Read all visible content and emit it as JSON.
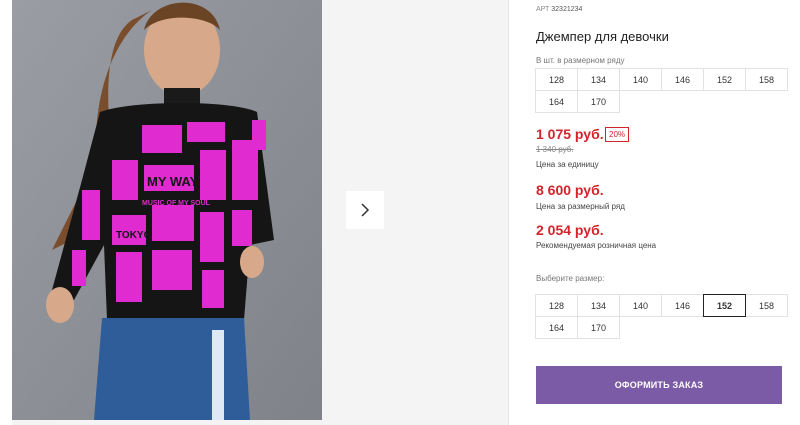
{
  "product": {
    "article_label": "АРТ",
    "article_number": "32321234",
    "title": "Джемпер для девочки"
  },
  "pack_sizes": {
    "label": "В шт. в размерном ряду",
    "sizes": [
      "128",
      "134",
      "140",
      "146",
      "152",
      "158",
      "164",
      "170"
    ]
  },
  "prices": {
    "unit_price": "1 075 руб.",
    "discount": "20%",
    "old_price": "1 340 руб.",
    "unit_caption": "Цена за единицу",
    "row_price": "8 600 руб.",
    "row_caption": "Цена за размерный ряд",
    "retail_price": "2 054 руб.",
    "retail_caption": "Рекомендуемая розничная цена"
  },
  "size_select": {
    "label": "Выберите размер:",
    "sizes": [
      "128",
      "134",
      "140",
      "146",
      "152",
      "158",
      "164",
      "170"
    ],
    "selected": "152"
  },
  "order_button": "ОФОРМИТЬ ЗАКАЗ",
  "gallery": {
    "next_icon": "chevron-right-icon",
    "sweater_text": [
      "MY WAY",
      "TOKYO",
      "MUSIC OF MY SOUL",
      "MY WAY"
    ]
  },
  "colors": {
    "price_red": "#d2242b",
    "button_purple": "#7b5aa6",
    "sweater_pink": "#e02bd0",
    "sweater_black": "#151515"
  }
}
